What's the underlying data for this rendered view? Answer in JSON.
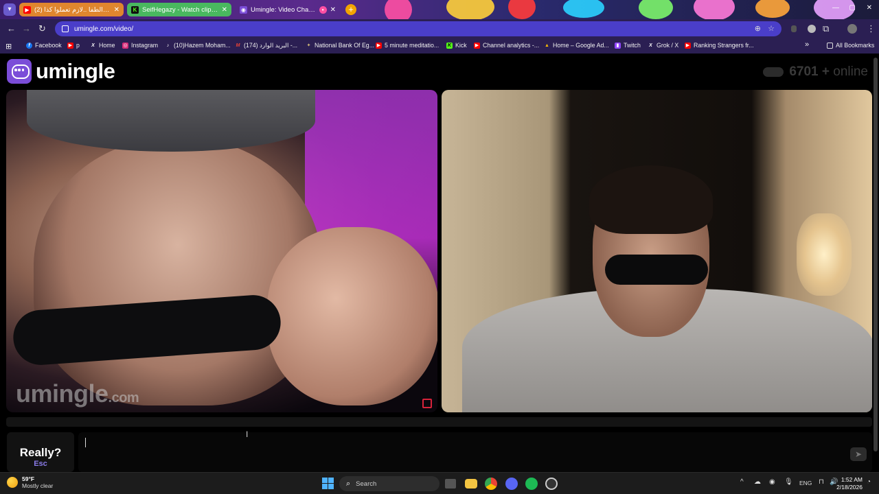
{
  "browser": {
    "tabs": [
      {
        "title": "(2) شايفين الطفا ..لازم تعملوا كذا",
        "favicon_color": "#ff0000",
        "favicon": "youtube-icon"
      },
      {
        "title": "SeifHegazy - Watch clips on Kick",
        "favicon_color": "#53fc18",
        "favicon": "kick-icon"
      },
      {
        "title": "Umingle: Video Chat with S",
        "favicon_color": "#7b4dd8",
        "favicon": "umingle-icon"
      }
    ],
    "url": "umingle.com/video/",
    "bookmarks": [
      {
        "label": "Facebook",
        "color": "#1877f2",
        "glyph": "f"
      },
      {
        "label": "p",
        "color": "#ff0000",
        "glyph": "▶"
      },
      {
        "label": "Home",
        "color": "#000000",
        "glyph": "X"
      },
      {
        "label": "Instagram",
        "color": "#d62976",
        "glyph": "◎"
      },
      {
        "label": "(10)Hazem Moham...",
        "color": "#000000",
        "glyph": "♪"
      },
      {
        "label": "(174) البريد الوارد -...",
        "color": "#ea4335",
        "glyph": "M"
      },
      {
        "label": "National Bank Of Eg...",
        "color": "#0a6b3a",
        "glyph": "✦"
      },
      {
        "label": "5 minute meditatio...",
        "color": "#ff0000",
        "glyph": "▶"
      },
      {
        "label": "Kick",
        "color": "#53fc18",
        "glyph": "K"
      },
      {
        "label": "Channel analytics -...",
        "color": "#ff0000",
        "glyph": "▶"
      },
      {
        "label": "Home – Google Ad...",
        "color": "#fbbc04",
        "glyph": "▲"
      },
      {
        "label": "Twitch",
        "color": "#9146ff",
        "glyph": "▮"
      },
      {
        "label": "Grok / X",
        "color": "#000000",
        "glyph": "X"
      },
      {
        "label": "Ranking Strangers fr...",
        "color": "#ff0000",
        "glyph": "▶"
      }
    ],
    "all_bookmarks": "All Bookmarks"
  },
  "page": {
    "logo_text": "umingle",
    "online_count": "6701",
    "online_suffix": "+",
    "online_label": "online",
    "watermark_main": "umingle",
    "watermark_suffix": ".com",
    "skip_title": "Really?",
    "skip_key": "Esc",
    "chat_placeholder": "",
    "send_icon": "send-icon"
  },
  "taskbar": {
    "temp": "59°F",
    "condition": "Mostly clear",
    "search_label": "Search",
    "language": "ENG",
    "time": "1:52 AM",
    "date": "2/18/2026"
  }
}
